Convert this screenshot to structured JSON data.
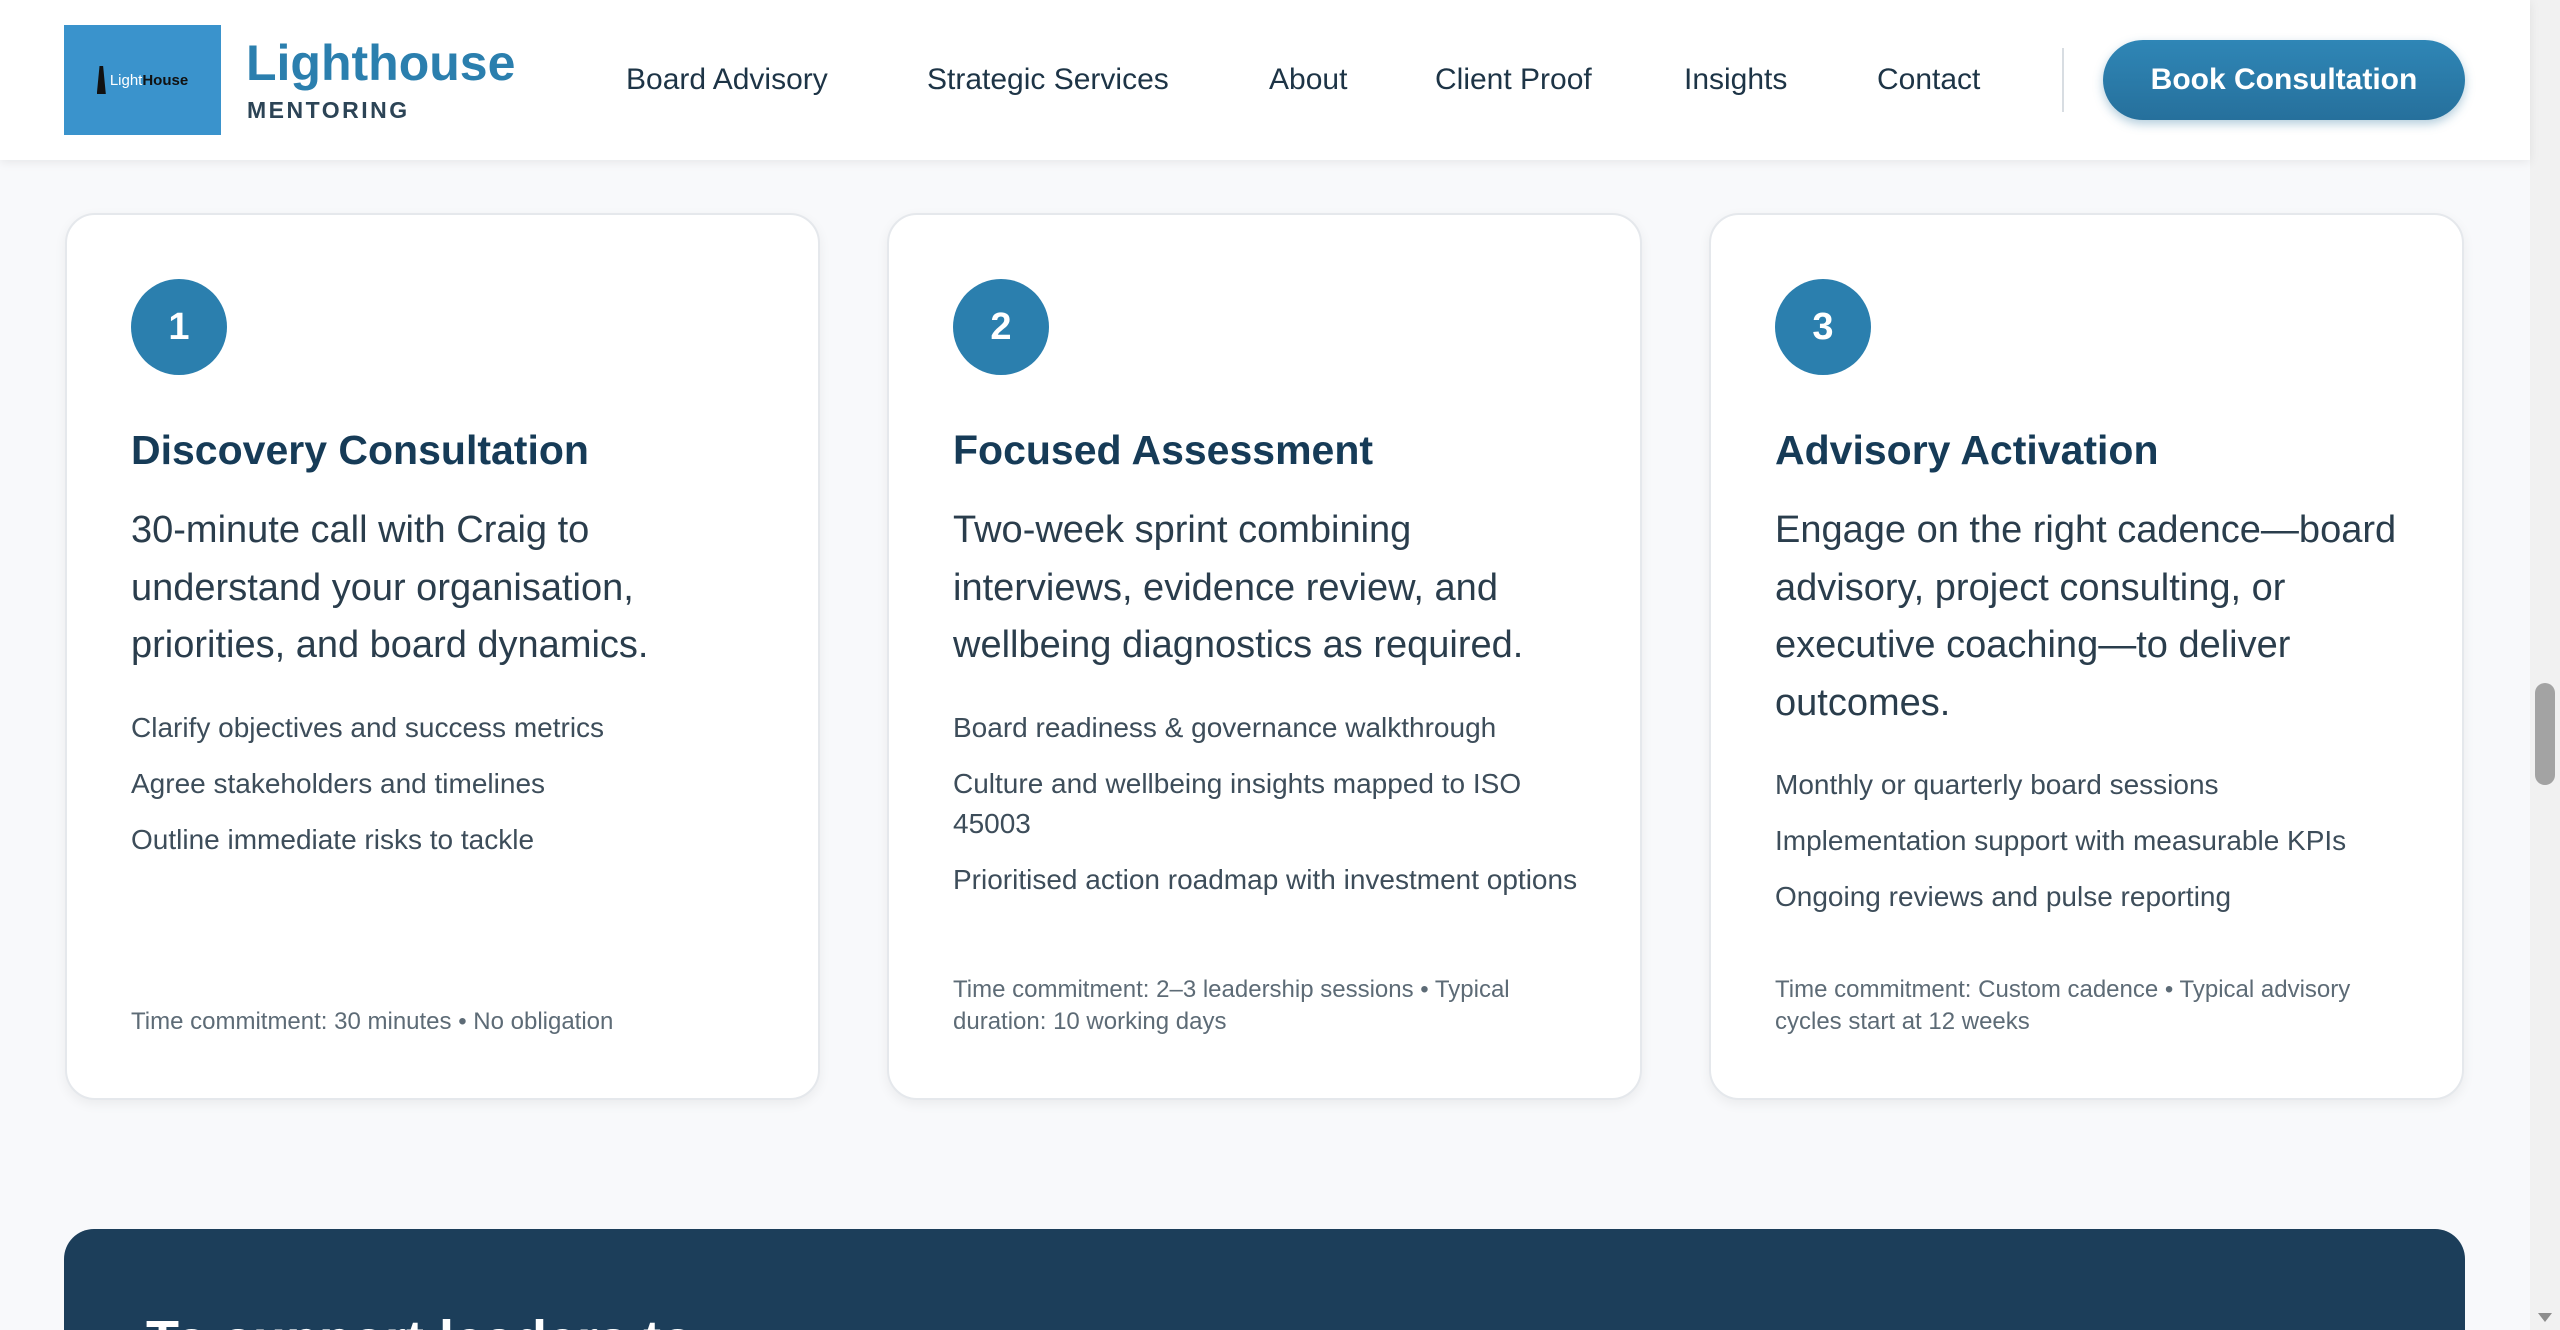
{
  "header": {
    "logo_text_light": "Light",
    "logo_text_dark": "House",
    "brand_title": "Lighthouse",
    "brand_subtitle": "MENTORING",
    "nav": [
      "Board Advisory",
      "Strategic Services",
      "About",
      "Client Proof",
      "Insights",
      "Contact"
    ],
    "cta_label": "Book Consultation"
  },
  "steps": [
    {
      "number": "1",
      "title": "Discovery Consultation",
      "description": "30-minute call with Craig to understand your organisation, priorities, and board dynamics.",
      "items": [
        "Clarify objectives and success metrics",
        "Agree stakeholders and timelines",
        "Outline immediate risks to tackle"
      ],
      "footer": "Time commitment: 30 minutes • No obligation"
    },
    {
      "number": "2",
      "title": "Focused Assessment",
      "description": "Two-week sprint combining interviews, evidence review, and wellbeing diagnostics as required.",
      "items": [
        "Board readiness & governance walkthrough",
        "Culture and wellbeing insights mapped to ISO 45003",
        "Prioritised action roadmap with investment options"
      ],
      "footer": "Time commitment: 2–3 leadership sessions • Typical duration: 10 working days"
    },
    {
      "number": "3",
      "title": "Advisory Activation",
      "description": "Engage on the right cadence—board advisory, project consulting, or executive coaching—to deliver outcomes.",
      "items": [
        "Monthly or quarterly board sessions",
        "Implementation support with measurable KPIs",
        "Ongoing reviews and pulse reporting"
      ],
      "footer": "Time commitment: Custom cadence • Typical advisory cycles start at 12 weeks"
    }
  ],
  "banner": {
    "title": "To support leaders to"
  },
  "colors": {
    "brand": "#2b7fae",
    "title": "#163b57",
    "banner": "#1c3e5a"
  }
}
